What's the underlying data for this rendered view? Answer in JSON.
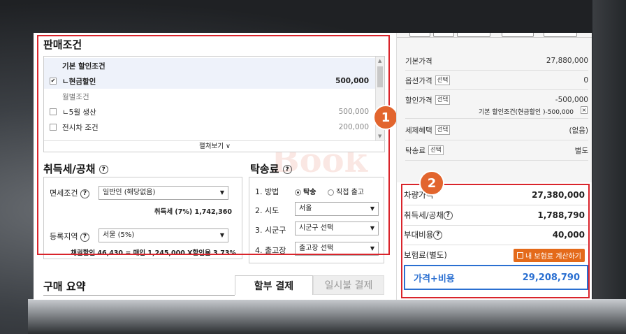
{
  "sale": {
    "title": "판매조건",
    "rows": [
      {
        "label": "기본 할인조건",
        "value": "",
        "checked": null,
        "bold": true,
        "hl": true
      },
      {
        "label": "ㄴ현금할인",
        "value": "500,000",
        "checked": true,
        "bold": true,
        "hl": true
      },
      {
        "label": "월별조건",
        "value": "",
        "checked": null,
        "bold": false,
        "hl": false
      },
      {
        "label": "ㄴ5월 생산",
        "value": "500,000",
        "checked": false,
        "bold": false,
        "hl": false
      },
      {
        "label": "전시차 조건",
        "value": "200,000",
        "checked": false,
        "bold": false,
        "hl": false
      }
    ],
    "expand": "펼쳐보기 ∨"
  },
  "tax": {
    "title": "취득세/공채",
    "exempt_label": "면세조건",
    "exempt_value": "일반인 (해당없음)",
    "tax_text": "취득세 (7%) 1,742,360",
    "region_label": "등록지역",
    "region_value": "서울 (5%)",
    "bond_text": "채권할인 46,430 = 매입 1,245,000 X할인율 3.73%"
  },
  "delivery": {
    "title": "탁송료",
    "method_label": "1. 방법",
    "opt1": "탁송",
    "opt2": "직접 출고",
    "city_label": "2. 시도",
    "city_value": "서울",
    "gu_label": "3. 시군구",
    "gu_value": "시군구 선택",
    "depot_label": "4. 출고장",
    "depot_value": "출고장 선택"
  },
  "summary_section": {
    "title": "구매 요약",
    "tab1": "할부 결제",
    "tab2": "일시불 결제"
  },
  "price": {
    "base_label": "기본가격",
    "base_value": "27,880,000",
    "option_label": "옵션가격",
    "option_value": "0",
    "discount_label": "할인가격",
    "discount_value": "-500,000",
    "discount_note": "기본 할인조건(현금할인 )-500,000",
    "discount_note_x": "×",
    "tax_benefit_label": "세제혜택",
    "tax_benefit_value": "(없음)",
    "delivery_label": "탁송료",
    "delivery_value": "별도",
    "select_tag": "선택"
  },
  "totals": {
    "car_label": "차량가격",
    "car_value": "27,380,000",
    "tax_label": "취득세/공채",
    "tax_value": "1,788,790",
    "extra_label": "부대비용",
    "extra_value": "40,000",
    "ins_label": "보험료(별도)",
    "ins_button": "내 보험료 계산하기",
    "grand_label": "가격+비용",
    "grand_value": "29,208,790"
  },
  "badges": {
    "one": "1",
    "two": "2"
  },
  "watermark": "Book",
  "colors": {
    "highlight_red": "#d9242b",
    "badge_orange": "#e2652e",
    "total_blue": "#2a6fd1",
    "calc_orange": "#e46a1a"
  }
}
